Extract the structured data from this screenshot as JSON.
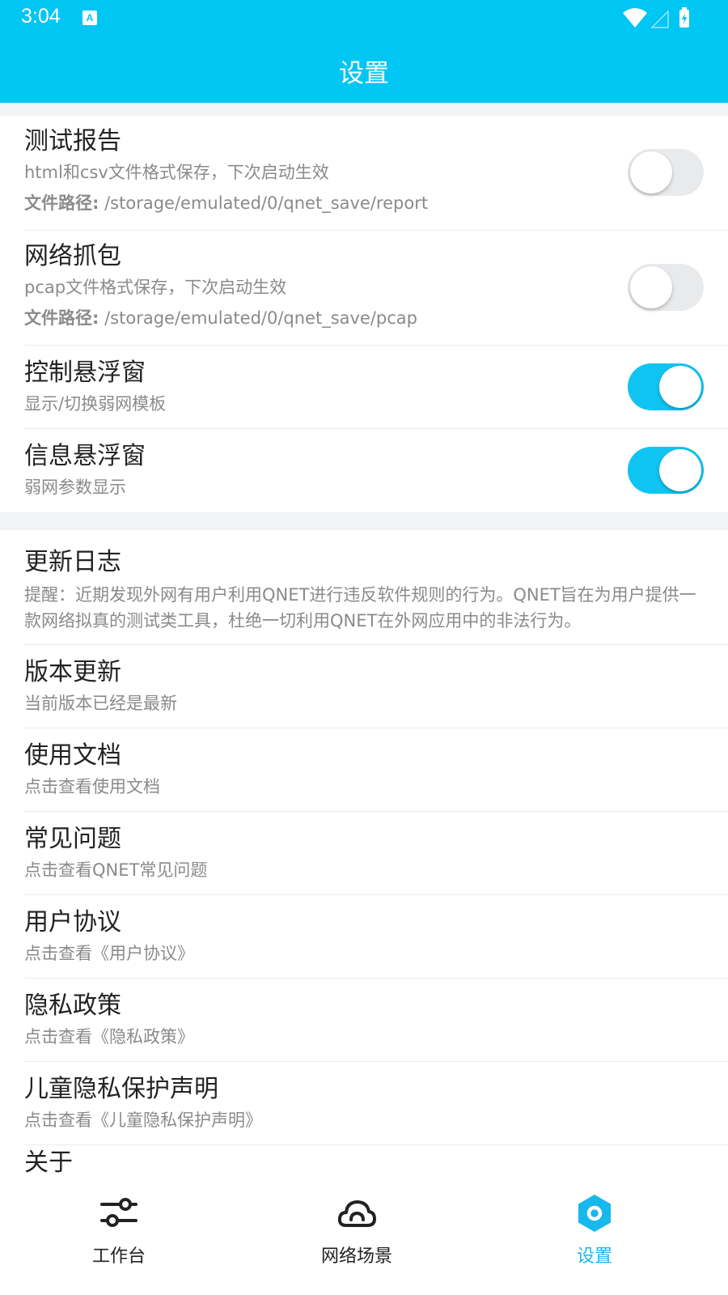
{
  "status_bar": {
    "time": "3:04",
    "notification_icon": "a-icon"
  },
  "header": {
    "title": "设置"
  },
  "toggles": [
    {
      "title": "测试报告",
      "subtitle": "html和csv文件格式保存，下次启动生效",
      "path_label": "文件路径:",
      "path": "/storage/emulated/0/qnet_save/report",
      "state": "off"
    },
    {
      "title": "网络抓包",
      "subtitle": "pcap文件格式保存，下次启动生效",
      "path_label": "文件路径:",
      "path": "/storage/emulated/0/qnet_save/pcap",
      "state": "off"
    },
    {
      "title": "控制悬浮窗",
      "subtitle": "显示/切换弱网模板",
      "state": "on"
    },
    {
      "title": "信息悬浮窗",
      "subtitle": "弱网参数显示",
      "state": "on"
    }
  ],
  "items": [
    {
      "title": "更新日志",
      "subtitle": "提醒：近期发现外网有用户利用QNET进行违反软件规则的行为。QNET旨在为用户提供一款网络拟真的测试类工具，杜绝一切利用QNET在外网应用中的非法行为。"
    },
    {
      "title": "版本更新",
      "subtitle": "当前版本已经是最新"
    },
    {
      "title": "使用文档",
      "subtitle": "点击查看使用文档"
    },
    {
      "title": "常见问题",
      "subtitle": "点击查看QNET常见问题"
    },
    {
      "title": "用户协议",
      "subtitle": "点击查看《用户协议》"
    },
    {
      "title": "隐私政策",
      "subtitle": "点击查看《隐私政策》"
    },
    {
      "title": "儿童隐私保护声明",
      "subtitle": "点击查看《儿童隐私保护声明》"
    },
    {
      "title": "关于"
    }
  ],
  "bottom_nav": [
    {
      "label": "工作台",
      "icon": "sliders-icon",
      "active": false
    },
    {
      "label": "网络场景",
      "icon": "cloud-icon",
      "active": false
    },
    {
      "label": "设置",
      "icon": "settings-hex-icon",
      "active": true
    }
  ],
  "colors": {
    "primary": "#00c6f4",
    "active": "#17b8ec",
    "toggle_off": "#e9eaec"
  }
}
